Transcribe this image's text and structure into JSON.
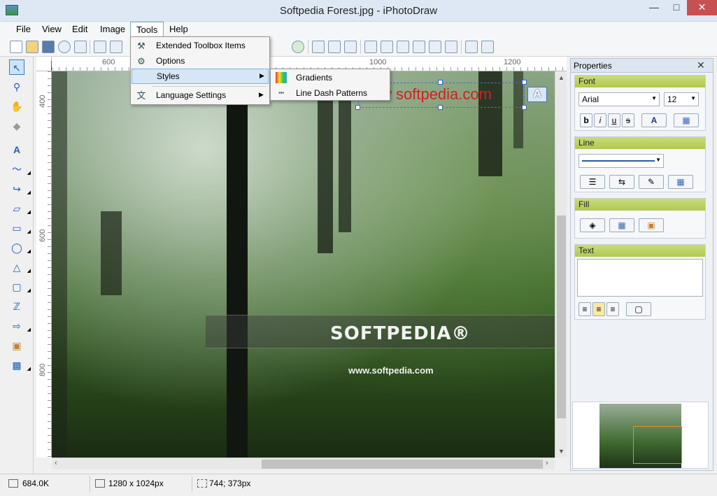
{
  "window": {
    "title": "Softpedia Forest.jpg - iPhotoDraw",
    "min": "—",
    "max": "□",
    "close": "✕"
  },
  "menu": {
    "file": "File",
    "view": "View",
    "edit": "Edit",
    "image": "Image",
    "tools": "Tools",
    "help": "Help"
  },
  "tools_menu": {
    "extended": "Extended Toolbox Items",
    "options": "Options",
    "styles": "Styles",
    "language": "Language Settings"
  },
  "styles_submenu": {
    "gradients": "Gradients",
    "line_dash": "Line Dash Patterns"
  },
  "ruler": {
    "h": [
      "600",
      "1000",
      "1200"
    ],
    "v": [
      "400",
      "600",
      "800"
    ]
  },
  "canvas": {
    "logo": "SOFTPEDIA®",
    "url": "www.softpedia.com",
    "text_object": "w softpedia.com"
  },
  "properties": {
    "title": "Properties",
    "close": "✕",
    "font_group": "Font",
    "font_name": "Arial",
    "font_size": "12",
    "bold": "b",
    "italic": "i",
    "underline": "u",
    "strike": "s",
    "font_color": "A",
    "line_group": "Line",
    "fill_group": "Fill",
    "text_group": "Text"
  },
  "status": {
    "file_size": "684.0K",
    "dimensions": "1280 x 1024px",
    "cursor": "744; 373px"
  }
}
